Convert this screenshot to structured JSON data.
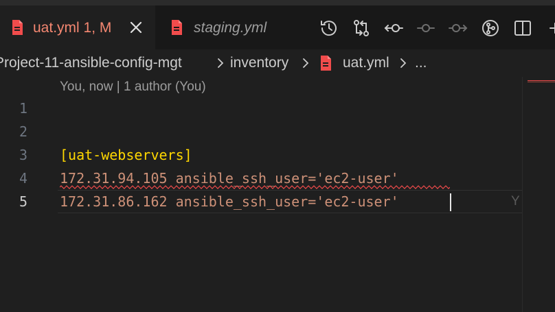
{
  "tabs": [
    {
      "label": "uat.yml",
      "status": "1, M",
      "active": true,
      "icon": "yaml-file-icon",
      "color": "#f48771"
    },
    {
      "label": "staging.yml",
      "active": false,
      "icon": "yaml-file-icon",
      "color": "#9d9d9d"
    }
  ],
  "toolbar": {
    "items": [
      {
        "name": "timeline-icon"
      },
      {
        "name": "compare-changes-icon"
      },
      {
        "name": "previous-change-icon"
      },
      {
        "name": "commit-icon"
      },
      {
        "name": "next-change-icon"
      },
      {
        "name": "gitlens-icon"
      },
      {
        "name": "split-editor-icon"
      },
      {
        "name": "more-actions-icon"
      }
    ]
  },
  "breadcrumb": {
    "items": [
      "Project-11-ansible-config-mgt",
      "inventory",
      "uat.yml",
      "..."
    ]
  },
  "editor": {
    "blame_header": "You, now | 1 author (You)",
    "line_numbers": [
      "1",
      "2",
      "3",
      "4",
      "5"
    ],
    "current_line": "5",
    "lines": {
      "l3": "[uat-webservers]",
      "l4": "172.31.94.105 ansible_ssh_user='ec2-user'",
      "l5": "172.31.86.162 ansible_ssh_user='ec2-user'"
    },
    "inline_blame": "Y"
  },
  "colors": {
    "accent_modified": "#f48771",
    "section": "#ffd700",
    "string": "#ce9178",
    "error_squiggle": "#f14c4c"
  }
}
